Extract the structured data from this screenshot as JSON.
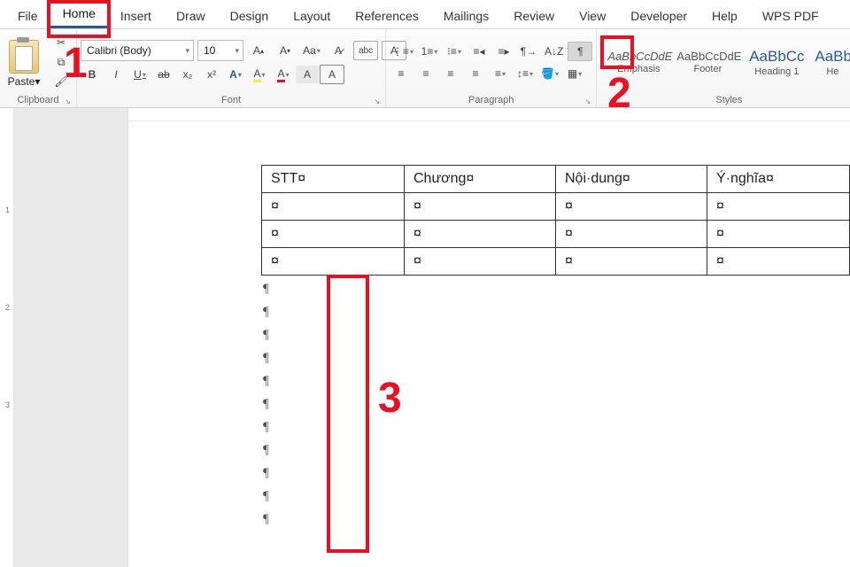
{
  "tabs": [
    "File",
    "Home",
    "Insert",
    "Draw",
    "Design",
    "Layout",
    "References",
    "Mailings",
    "Review",
    "View",
    "Developer",
    "Help",
    "WPS PDF"
  ],
  "active_tab": 1,
  "clipboard": {
    "title": "Clipboard",
    "paste": "Paste"
  },
  "font": {
    "title": "Font",
    "name": "Calibri (Body)",
    "size": "10",
    "bold": "B",
    "italic": "I",
    "underline": "U",
    "strike": "ab",
    "sub": "x₂",
    "sup": "x²",
    "effects": "A",
    "highlight": "A",
    "color": "A",
    "glow": "A",
    "shade": "A",
    "box": "A"
  },
  "paragraph": {
    "title": "Paragraph",
    "pilcrow": "¶"
  },
  "styles": {
    "title": "Styles",
    "items": [
      {
        "preview": "AaBbCcDdE",
        "name": "Emphasis",
        "italic": true
      },
      {
        "preview": "AaBbCcDdE",
        "name": "Footer",
        "italic": false
      },
      {
        "preview": "AaBbCc",
        "name": "Heading 1",
        "big": true
      },
      {
        "preview": "AaBbC",
        "name": "He",
        "big": true
      }
    ]
  },
  "table": {
    "headers": [
      "STT¤",
      "Chương¤",
      "Nội·dung¤",
      "Ý·nghĩa¤"
    ],
    "rows": [
      [
        "¤",
        "¤",
        "¤",
        "¤"
      ],
      [
        "¤",
        "¤",
        "¤",
        "¤"
      ],
      [
        "¤",
        "¤",
        "¤",
        "¤"
      ]
    ]
  },
  "paragraph_marks_count": 11,
  "annotations": {
    "n1": "1",
    "n2": "2",
    "n3": "3"
  },
  "ruler_marks": [
    "1",
    "2",
    "3"
  ]
}
